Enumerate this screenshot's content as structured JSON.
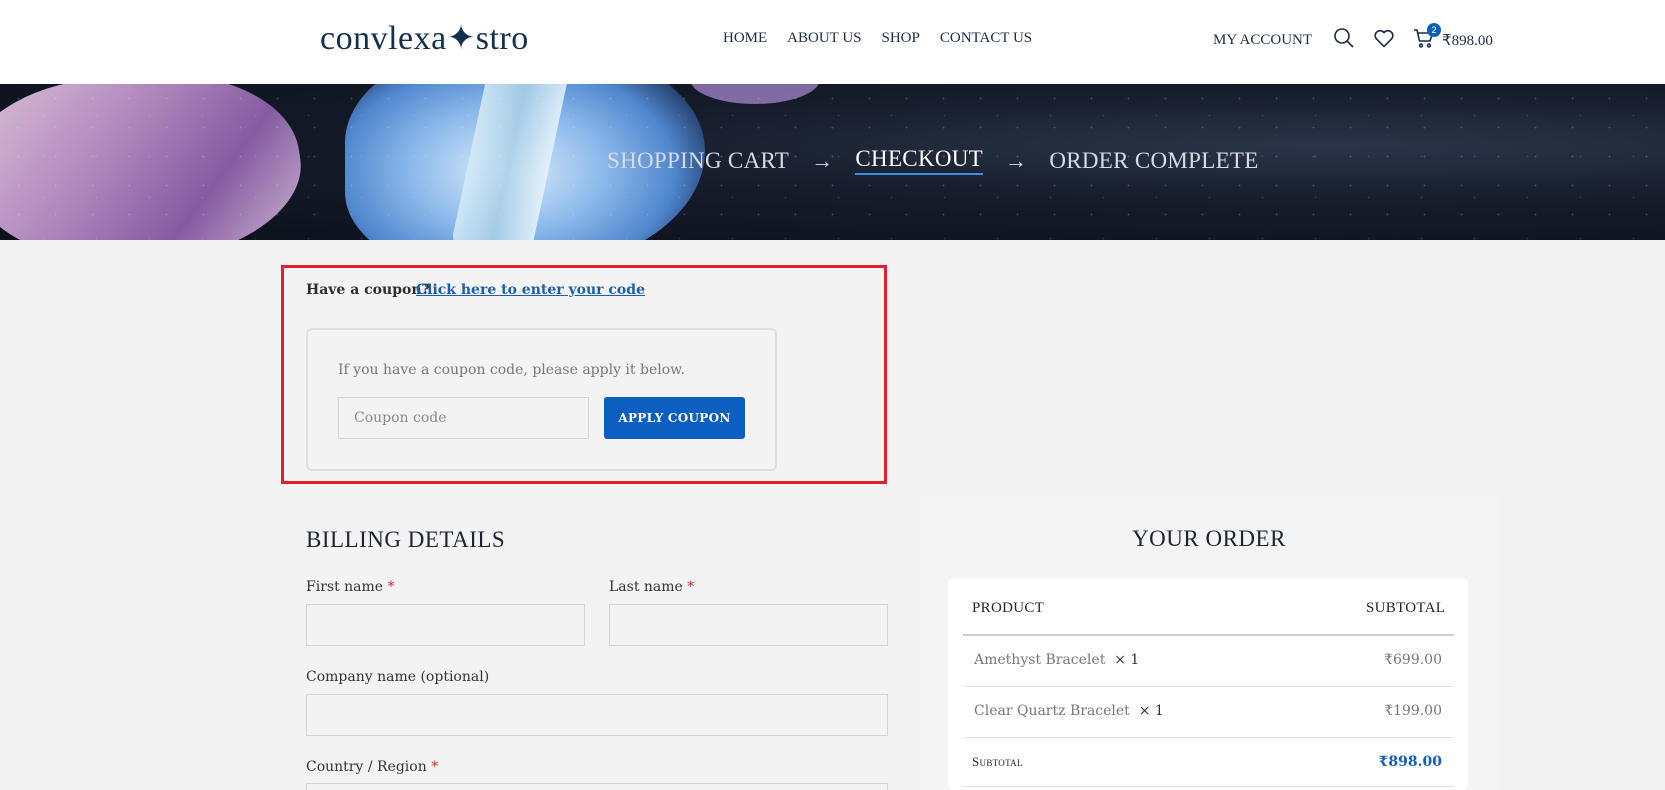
{
  "header": {
    "logo": "convlexa✦stro",
    "nav": [
      "HOME",
      "ABOUT US",
      "SHOP",
      "CONTACT US"
    ],
    "my_account": "MY ACCOUNT",
    "cart_count": "2",
    "cart_total": "₹898.00",
    "icons": [
      "search-icon",
      "heart-icon",
      "cart-icon"
    ]
  },
  "steps": {
    "step1": "SHOPPING CART",
    "step2": "CHECKOUT",
    "step3": "ORDER COMPLETE",
    "arrow": "→"
  },
  "coupon": {
    "question": "Have a coupon?",
    "link": "Click here to enter your code",
    "info": "If you have a coupon code, please apply it below.",
    "placeholder": "Coupon code",
    "value": "",
    "apply_label": "APPLY COUPON",
    "highlight_color": "#e0202a"
  },
  "billing": {
    "title": "BILLING DETAILS",
    "first_name_label": "First name",
    "last_name_label": "Last name",
    "company_label": "Company name (optional)",
    "country_label": "Country / Region",
    "required_mark": "*"
  },
  "order": {
    "title": "YOUR ORDER",
    "col_product": "PRODUCT",
    "col_subtotal": "SUBTOTAL",
    "items": [
      {
        "name": "Amethyst Bracelet",
        "qty": "× 1",
        "price": "₹699.00"
      },
      {
        "name": "Clear Quartz Bracelet",
        "qty": "× 1",
        "price": "₹199.00"
      }
    ],
    "subtotal_label": "Subtotal",
    "subtotal_value": "₹898.00"
  },
  "colors": {
    "accent": "#0b5fc1",
    "required": "#d2232a",
    "navy": "#1d2b44"
  }
}
